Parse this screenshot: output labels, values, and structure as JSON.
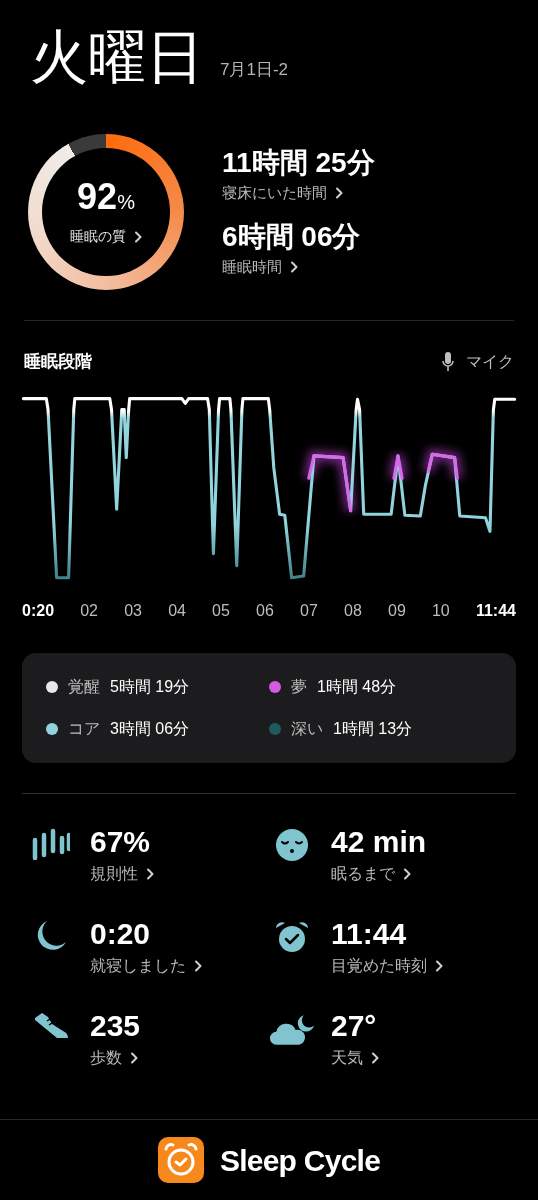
{
  "header": {
    "day": "火曜日",
    "date": "7月1日-2"
  },
  "quality": {
    "value": "92",
    "unit": "%",
    "label": "睡眠の質"
  },
  "durations": [
    {
      "value": "11時間 25分",
      "label": "寝床にいた時間"
    },
    {
      "value": "6時間 06分",
      "label": "睡眠時間"
    }
  ],
  "stages": {
    "title": "睡眠段階",
    "mic_label": "マイク",
    "time_labels": [
      {
        "text": "0:20",
        "bold": true
      },
      {
        "text": "02",
        "bold": false
      },
      {
        "text": "03",
        "bold": false
      },
      {
        "text": "04",
        "bold": false
      },
      {
        "text": "05",
        "bold": false
      },
      {
        "text": "06",
        "bold": false
      },
      {
        "text": "07",
        "bold": false
      },
      {
        "text": "08",
        "bold": false
      },
      {
        "text": "09",
        "bold": false
      },
      {
        "text": "10",
        "bold": false
      },
      {
        "text": "11:44",
        "bold": true
      }
    ],
    "legend": [
      {
        "label": "覚醒",
        "value": "5時間 19分",
        "color": "#e8e8e8"
      },
      {
        "label": "夢",
        "value": "1時間 48分",
        "color": "#d35be0"
      },
      {
        "label": "コア",
        "value": "3時間 06分",
        "color": "#8fd3dc"
      },
      {
        "label": "深い",
        "value": "1時間 13分",
        "color": "#1f5a60"
      }
    ]
  },
  "stats": [
    {
      "kind": "regularity",
      "value": "67%",
      "label": "規則性"
    },
    {
      "kind": "fall_asleep",
      "value": "42 min",
      "label": "眠るまで"
    },
    {
      "kind": "bedtime",
      "value": "0:20",
      "label": "就寝しました"
    },
    {
      "kind": "wakeup",
      "value": "11:44",
      "label": "目覚めた時刻"
    },
    {
      "kind": "steps",
      "value": "235",
      "label": "歩数"
    },
    {
      "kind": "weather",
      "value": "27°",
      "label": "天気"
    }
  ],
  "footer": {
    "app_name": "Sleep Cycle"
  }
}
